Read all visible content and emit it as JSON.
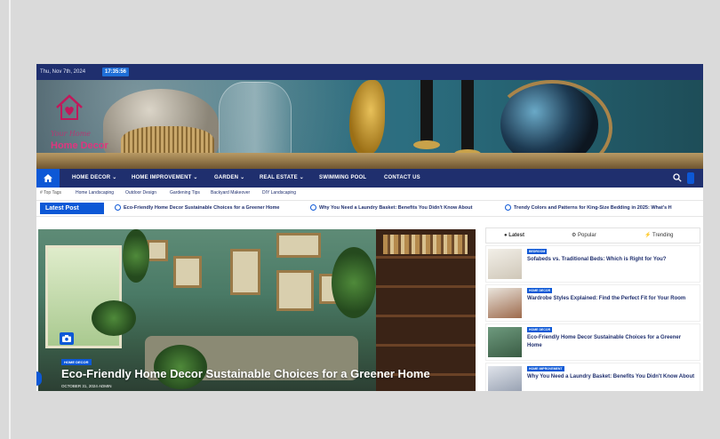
{
  "topbar": {
    "date": "Thu, Nov 7th, 2024",
    "time": "17:35:56"
  },
  "logo": {
    "script": "Your Home",
    "name": "Home Decor"
  },
  "nav": {
    "items": [
      "HOME DECOR ⌄",
      "HOME IMPROVEMENT ⌄",
      "GARDEN ⌄",
      "REAL ESTATE ⌄",
      "SWIMMING POOL",
      "CONTACT US"
    ]
  },
  "tags": {
    "header": "# Top Tags",
    "items": [
      "Home Landscaping",
      "Outdoor Design",
      "Gardening Tips",
      "Backyard Makeover",
      "DIY Landscaping"
    ]
  },
  "latest": {
    "label": "Latest Post",
    "ticker": [
      "Eco-Friendly Home Decor Sustainable Choices for a Greener Home",
      "Why You Need a Laundry Basket: Benefits You Didn't Know About",
      "Trendy Colors and Patterns for King-Size Bedding in 2025: What's H"
    ]
  },
  "feature": {
    "category": "HOME DECOR",
    "title": "Eco-Friendly Home Decor Sustainable Choices for a Greener Home",
    "meta": "OCTOBER 31, 2024  ADMIN"
  },
  "sidebar": {
    "tabs": [
      "Latest",
      "Popular",
      "Trending"
    ],
    "posts": [
      {
        "category": "BEDROOM",
        "title": "Sofabeds vs. Traditional Beds: Which is Right for You?"
      },
      {
        "category": "HOME DECOR",
        "title": "Wardrobe Styles Explained: Find the Perfect Fit for Your Room"
      },
      {
        "category": "HOME DECOR",
        "title": "Eco-Friendly Home Decor Sustainable Choices for a Greener Home"
      },
      {
        "category": "HOME IMPROVEMENT",
        "title": "Why You Need a Laundry Basket: Benefits You Didn't Know About"
      }
    ]
  },
  "colors": {
    "navy": "#1f2f6e",
    "accent": "#0d58d6",
    "logo_pink": "#e0357f"
  }
}
